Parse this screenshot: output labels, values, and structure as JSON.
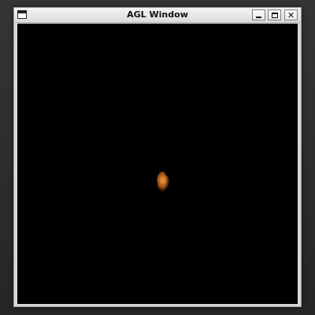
{
  "window": {
    "title": "AGL Window",
    "controls": {
      "menu_icon": "window-menu-icon",
      "minimize_icon": "minimize-icon",
      "maximize_icon": "maximize-icon",
      "close_icon": "close-icon"
    }
  },
  "canvas": {
    "background": "#000000",
    "object_color": "#b8661e"
  }
}
